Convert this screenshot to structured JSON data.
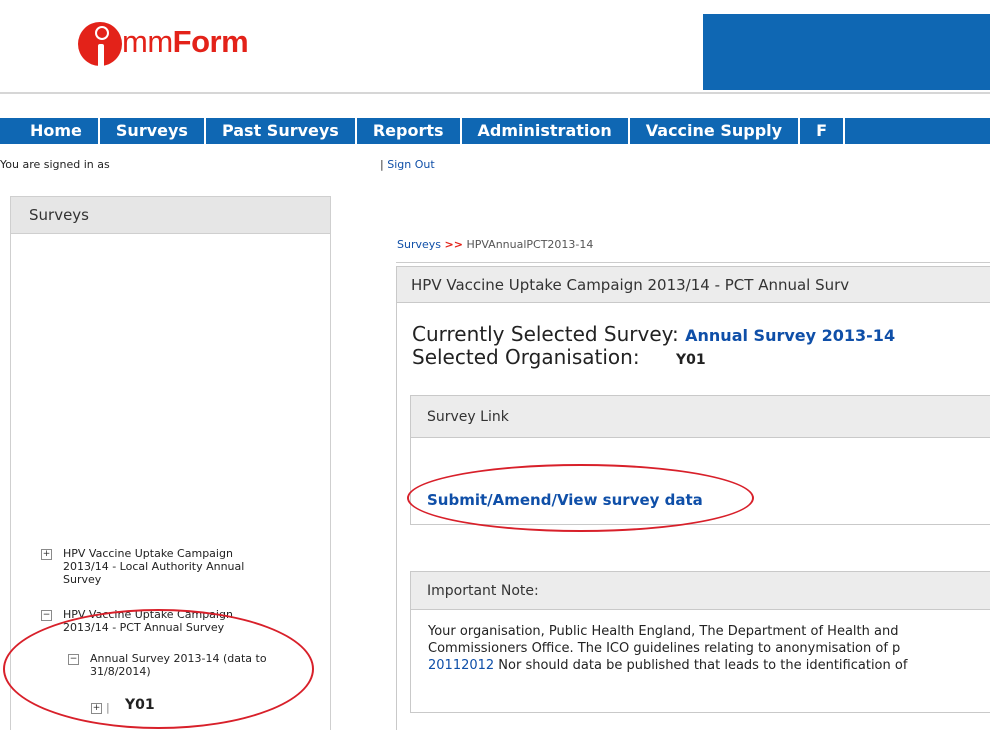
{
  "header": {
    "logo_text_light": "mm",
    "logo_text_bold": "Form",
    "banner_color": "#0f67b3",
    "accent_color": "#e32219"
  },
  "nav": {
    "items": [
      "Home",
      "Surveys",
      "Past Surveys",
      "Reports",
      "Administration",
      "Vaccine Supply",
      "F"
    ]
  },
  "user": {
    "signed_in_label": "You are signed in as",
    "separator": "|",
    "sign_out": "Sign Out"
  },
  "sidebar": {
    "title": "Surveys",
    "tree": {
      "item1": {
        "toggle": "+",
        "lines": [
          "HPV Vaccine Uptake Campaign",
          "2013/14 - Local Authority Annual",
          "Survey"
        ]
      },
      "item2": {
        "toggle": "−",
        "lines": [
          "HPV Vaccine Uptake Campaign",
          "2013/14 - PCT Annual Survey"
        ]
      },
      "item3": {
        "toggle": "−",
        "lines": [
          "Annual Survey 2013-14 (data to",
          "31/8/2014)"
        ]
      },
      "item4": {
        "toggle": "+",
        "separator": "|",
        "label": "Y01"
      }
    }
  },
  "breadcrumb": {
    "root": "Surveys",
    "arrows": ">>",
    "current": "HPVAnnualPCT2013-14"
  },
  "main": {
    "panel_title": "HPV Vaccine Uptake Campaign 2013/14 - PCT Annual Surv",
    "selected_survey_label": "Currently Selected Survey:",
    "selected_survey_value": "Annual Survey 2013-14",
    "selected_org_label": "Selected Organisation:",
    "selected_org_value": "Y01",
    "survey_link_title": "Survey Link",
    "submit_link": "Submit/Amend/View survey data",
    "note_title": "Important Note:",
    "note_line1": "Your organisation, Public Health England, The Department of Health and",
    "note_line2": "Commissioners Office. The ICO guidelines relating to anonymisation of p",
    "note_line3_link": "20112012",
    "note_line3_rest": " Nor should data be published that leads to the identification of"
  }
}
